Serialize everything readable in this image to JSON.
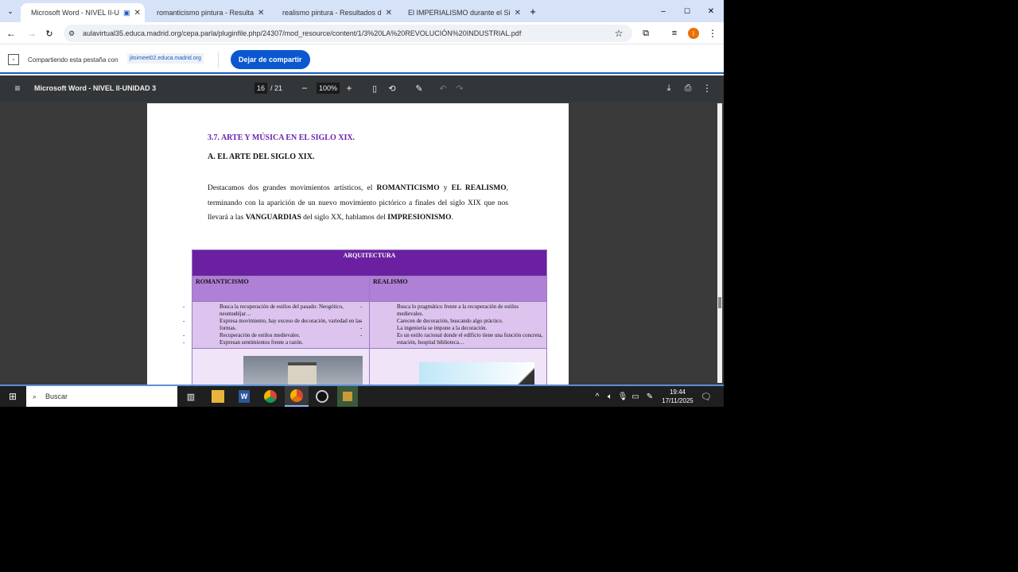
{
  "tabs": [
    {
      "title": "Microsoft Word - NIVEL II-U",
      "active": true,
      "color": "#c0392b"
    },
    {
      "title": "romanticismo pintura - Resulta",
      "active": false,
      "color": "#6a1fb0"
    },
    {
      "title": "realismo pintura - Resultados d",
      "active": false,
      "color": "#6a1fb0"
    },
    {
      "title": "El IMPERIALISMO durante el Si",
      "active": false,
      "color": "#e00"
    }
  ],
  "url": "aulavirtual35.educa.madrid.org/cepa.parla/pluginfile.php/24307/mod_resource/content/1/3%20LA%20REVOLUCIÓN%20INDUSTRIAL.pdf",
  "share": {
    "text": "Compartiendo esta pestaña con",
    "target": "jitsimeet02.educa.madrid.org",
    "button": "Dejar de compartir"
  },
  "pdf": {
    "title": "Microsoft Word - NIVEL II-UNIDAD 3",
    "page": "16",
    "total": "/ 21",
    "zoom": "100%"
  },
  "doc": {
    "heading": "3.7. ARTE Y MÚSICA EN EL SIGLO XIX.",
    "subheading": "A. EL ARTE DEL SIGLO XIX.",
    "p": [
      "Destacamos dos grandes movimientos artísticos, el ",
      "ROMANTICISMO",
      " y ",
      "EL REALISMO",
      ", terminando con la aparición de un nuevo movimiento pictórico a finales del siglo XIX que nos llevará a las ",
      "VANGUARDIAS",
      " del siglo XX, hablamos del ",
      "IMPRESIONISMO",
      "."
    ],
    "table": {
      "title": "ARQUITECTURA",
      "col1": "ROMANTICISMO",
      "col2": "REALISMO",
      "items1": [
        "Busca la recuperación de estilos del pasado: Neogótico, neomudéjar…",
        "Expresa movimiento, hay exceso de decoración, variedad en las formas.",
        "Recuperación de estilos medievales.",
        "Expresan sentimientos frente a razón."
      ],
      "items2": [
        "Busca lo pragmático frente a la recuperación de estilos medievales.",
        "Carecen de decoración, buscando algo práctico.",
        "La ingeniería se impone a la decoración.",
        "Es un estilo racional donde el edificio tiene una función concreta, estación, hospital biblioteca…"
      ]
    }
  },
  "taskbar": {
    "search": "Buscar",
    "time": "19:44",
    "date": "17/11/2025"
  }
}
